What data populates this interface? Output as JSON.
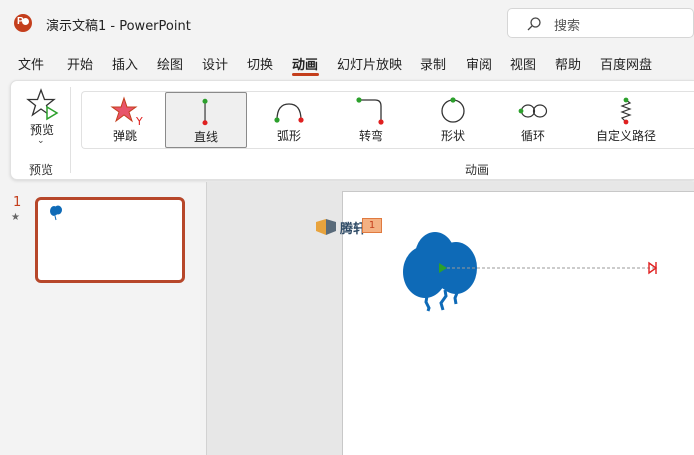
{
  "titlebar": {
    "title": "演示文稿1  -  PowerPoint",
    "search_placeholder": "搜索"
  },
  "menu": {
    "items": [
      "文件",
      "开始",
      "插入",
      "绘图",
      "设计",
      "切换",
      "动画",
      "幻灯片放映",
      "录制",
      "审阅",
      "视图",
      "帮助",
      "百度网盘"
    ],
    "active": "动画"
  },
  "ribbon": {
    "preview": {
      "label": "预览",
      "group_label": "预览"
    },
    "animations": {
      "group_label": "动画",
      "items": [
        {
          "label": "弹跳",
          "icon": "bounce-star-icon"
        },
        {
          "label": "直线",
          "icon": "line-path-icon",
          "selected": true
        },
        {
          "label": "弧形",
          "icon": "arc-path-icon"
        },
        {
          "label": "转弯",
          "icon": "turn-path-icon"
        },
        {
          "label": "形状",
          "icon": "shape-path-icon"
        },
        {
          "label": "循环",
          "icon": "loop-path-icon"
        },
        {
          "label": "自定义路径",
          "icon": "custom-path-icon"
        }
      ]
    }
  },
  "slides_pane": {
    "slides": [
      {
        "number": "1",
        "has_animation": "★"
      }
    ]
  },
  "slide": {
    "watermark": "腾轩",
    "animation_tag": "1",
    "colors": {
      "balloon": "#0e6ab7",
      "path_start": "#2ca02c",
      "path_end": "#e02020",
      "accent": "#c43e1c"
    }
  }
}
